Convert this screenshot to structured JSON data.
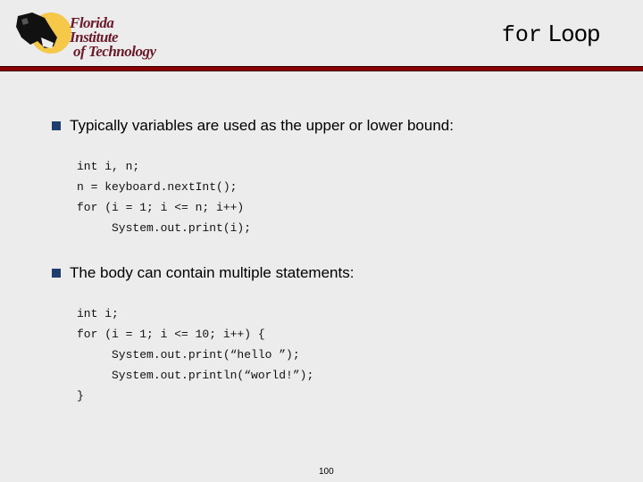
{
  "logo": {
    "line1": "Florida Institute",
    "line2": "of Technology"
  },
  "slide": {
    "title_code": "for",
    "title_word": "Loop",
    "bullets": [
      {
        "text": "Typically variables are used as the upper or lower bound:",
        "code": [
          "int i, n;",
          "n = keyboard.nextInt();",
          "for (i = 1; i <= n; i++)",
          "     System.out.print(i);"
        ]
      },
      {
        "text": "The body can contain multiple statements:",
        "code": [
          "int i;",
          "for (i = 1; i <= 10; i++) {",
          "     System.out.print(“hello ”);",
          "     System.out.println(“world!”);",
          "}"
        ]
      }
    ],
    "page_number": "100"
  },
  "colors": {
    "accent_rule": "#8b0000",
    "bullet": "#1f3e6e",
    "logo_text": "#6b1a2a",
    "logo_sun": "#f5c84a"
  }
}
